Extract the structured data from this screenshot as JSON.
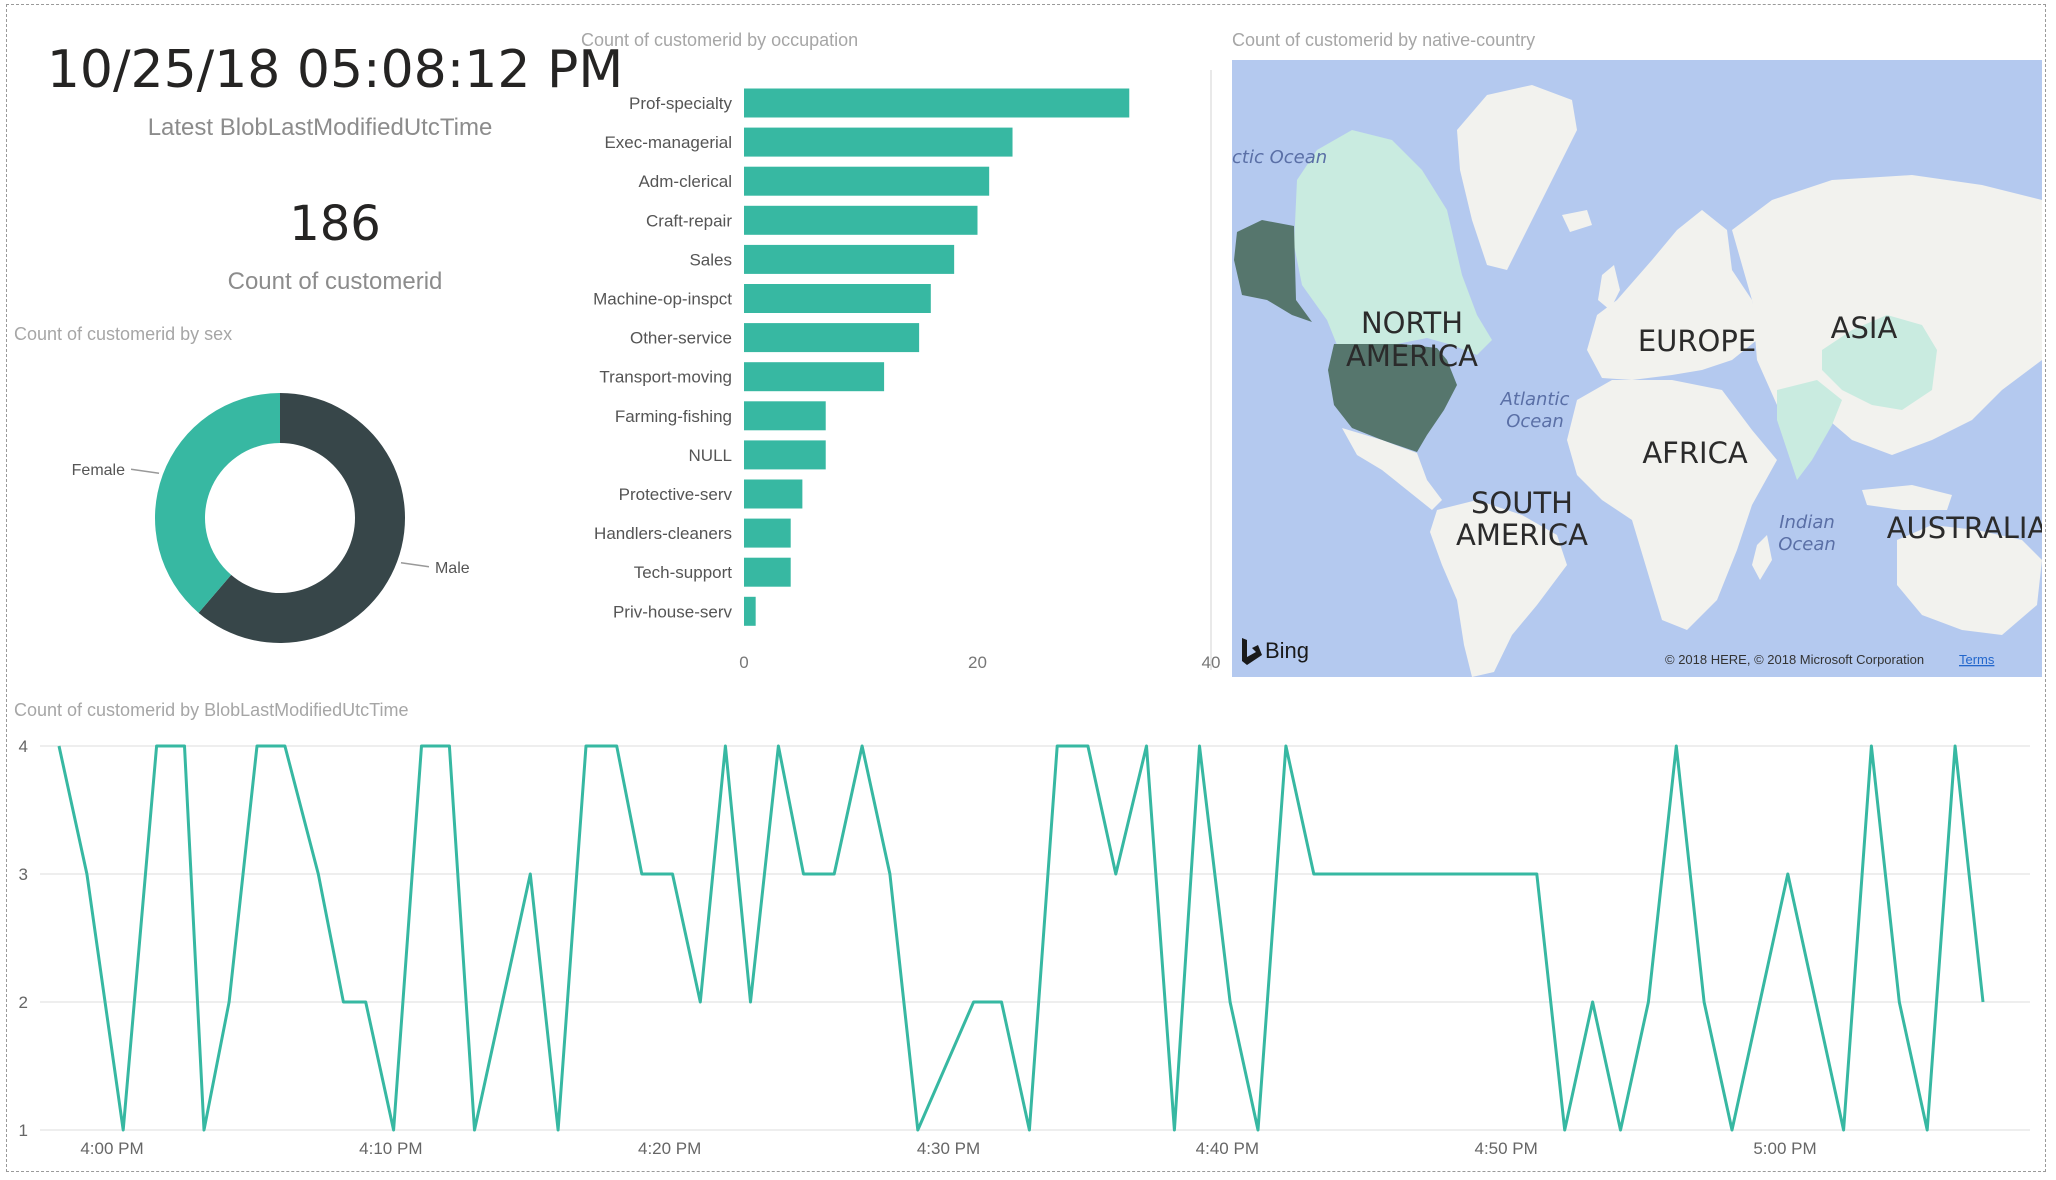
{
  "kpi_time": {
    "value": "10/25/18 05:08:12 PM",
    "label": "Latest BlobLastModifiedUtcTime"
  },
  "kpi_count": {
    "value": "186",
    "label": "Count of customerid"
  },
  "map": {
    "title": "Count of customerid by native-country",
    "labels": {
      "north": "NORTH",
      "america": "AMERICA",
      "europe": "EUROPE",
      "asia": "ASIA",
      "africa": "AFRICA",
      "south": "SOUTH",
      "america2": "AMERICA",
      "australia": "AUSTRALIA"
    },
    "oceans": {
      "arctic": "ctic Ocean",
      "atlantic1": "Atlantic",
      "atlantic2": "Ocean",
      "indian1": "Indian",
      "indian2": "Ocean"
    },
    "bing": "Bing",
    "copyright": "© 2018 HERE, © 2018 Microsoft Corporation",
    "terms": "Terms",
    "colors": {
      "water": "#b4c9ef",
      "land": "#f2f2ee",
      "highlight_light": "#c9ebe0",
      "highlight_dark": "#56766d"
    }
  },
  "colors": {
    "teal": "#37b8a2",
    "dark": "#374649",
    "grid": "#e9e9e9",
    "axis_text": "#666666"
  },
  "chart_data": [
    {
      "type": "pie",
      "title": "Count of customerid by sex",
      "variant": "donut",
      "categories": [
        "Female",
        "Male"
      ],
      "values": [
        72,
        114
      ],
      "colors": [
        "#37b8a2",
        "#374649"
      ]
    },
    {
      "type": "bar",
      "orientation": "horizontal",
      "title": "Count of customerid by occupation",
      "categories": [
        "Prof-specialty",
        "Exec-managerial",
        "Adm-clerical",
        "Craft-repair",
        "Sales",
        "Machine-op-inspct",
        "Other-service",
        "Transport-moving",
        "Farming-fishing",
        "NULL",
        "Protective-serv",
        "Handlers-cleaners",
        "Tech-support",
        "Priv-house-serv"
      ],
      "values": [
        33,
        23,
        21,
        20,
        18,
        16,
        15,
        12,
        7,
        7,
        5,
        4,
        4,
        1
      ],
      "xlim": [
        0,
        40
      ],
      "xticks": [
        0,
        20,
        40
      ],
      "color": "#37b8a2"
    },
    {
      "type": "line",
      "title": "Count of customerid by BlobLastModifiedUtcTime",
      "x_ticks": [
        "4:00 PM",
        "4:10 PM",
        "4:20 PM",
        "4:30 PM",
        "4:40 PM",
        "4:50 PM",
        "5:00 PM"
      ],
      "x_tick_minutes": [
        960,
        970,
        980,
        990,
        1000,
        1010,
        1020
      ],
      "ylim": [
        1,
        4
      ],
      "yticks": [
        1,
        2,
        3,
        4
      ],
      "grid": true,
      "color": "#37b8a2",
      "x_minutes": [
        958.1,
        959.1,
        960.4,
        961.6,
        962.6,
        963.3,
        964.2,
        965.2,
        966.2,
        967.4,
        968.3,
        969.1,
        970.1,
        971.1,
        972.1,
        973.0,
        974.0,
        975.0,
        976.0,
        977.0,
        978.1,
        979.0,
        980.1,
        981.1,
        982.0,
        982.9,
        983.9,
        984.8,
        985.9,
        986.9,
        987.9,
        988.9,
        990.9,
        991.9,
        992.9,
        993.9,
        995.0,
        996.0,
        997.1,
        998.1,
        999.0,
        1000.1,
        1001.1,
        1002.1,
        1003.1,
        1004.1,
        1011.1,
        1012.1,
        1013.1,
        1014.1,
        1015.1,
        1016.1,
        1017.1,
        1018.1,
        1019.1,
        1020.1,
        1021.1,
        1022.1,
        1023.1,
        1024.1,
        1025.1,
        1026.1,
        1027.1
      ],
      "values": [
        4,
        3,
        1,
        4,
        4,
        1,
        2,
        4,
        4,
        3,
        2,
        2,
        1,
        4,
        4,
        1,
        2,
        3,
        1,
        4,
        4,
        3,
        3,
        2,
        4,
        2,
        4,
        3,
        3,
        4,
        3,
        1,
        2,
        2,
        1,
        4,
        4,
        3,
        4,
        1,
        4,
        2,
        1,
        4,
        3,
        3,
        3,
        1,
        2,
        1,
        2,
        4,
        2,
        1,
        2,
        3,
        2,
        1,
        4,
        2,
        1,
        4,
        2
      ]
    }
  ]
}
